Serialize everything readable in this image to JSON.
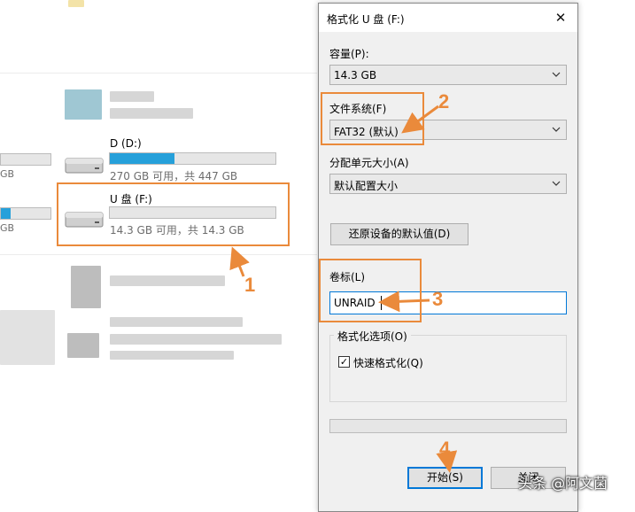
{
  "explorer": {
    "drives": [
      {
        "label": "D (D:)",
        "usage": "270 GB 可用，共 447 GB",
        "used_fraction": 0.4
      },
      {
        "label": "U 盘 (F:)",
        "usage": "14.3 GB 可用，共 14.3 GB",
        "used_fraction": 0.0
      }
    ],
    "left_fragments": [
      "GB",
      "GB"
    ],
    "left_bar_fill_fraction": 0.2
  },
  "dialog": {
    "title": "格式化 U 盘 (F:)",
    "close_glyph": "✕",
    "capacity_label": "容量(P):",
    "capacity_value": "14.3 GB",
    "filesystem_label": "文件系统(F)",
    "filesystem_value": "FAT32 (默认)",
    "allocation_label": "分配单元大小(A)",
    "allocation_value": "默认配置大小",
    "restore_button": "还原设备的默认值(D)",
    "volume_label": "卷标(L)",
    "volume_value": "UNRAID",
    "format_options_label": "格式化选项(O)",
    "quick_format_label": "快速格式化(Q)",
    "quick_format_checked": "✓",
    "start_button": "开始(S)",
    "close_button": "关闭"
  },
  "annotations": {
    "step1": "1",
    "step2": "2",
    "step3": "3",
    "step4": "4",
    "accent_color": "#ea8a3b"
  },
  "watermark": "头条 @阿文菌",
  "icons": {
    "drive": "usb-drive-icon",
    "chevron": "chevron-down-icon",
    "close": "close-icon"
  }
}
